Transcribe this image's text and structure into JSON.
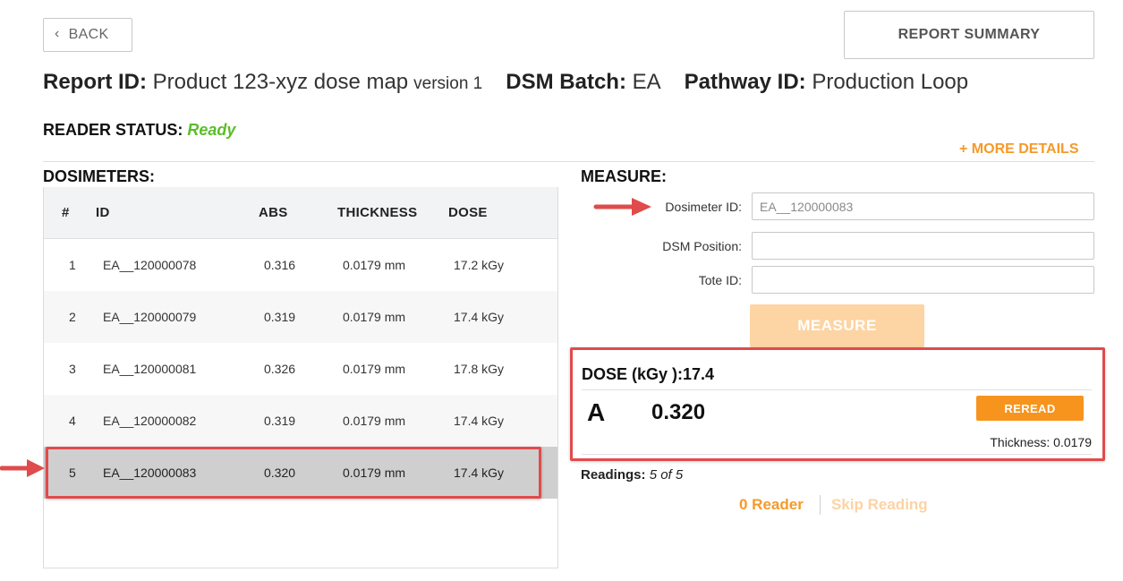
{
  "toolbar": {
    "back_label": "BACK",
    "report_summary_label": "REPORT SUMMARY"
  },
  "header": {
    "report_id_label": "Report ID:",
    "report_id_value": "Product 123-xyz dose map",
    "report_version": "version 1",
    "dsm_batch_label": "DSM Batch:",
    "dsm_batch_value": "EA",
    "pathway_id_label": "Pathway ID:",
    "pathway_id_value": "Production Loop"
  },
  "reader_status": {
    "label": "READER STATUS:",
    "value": "Ready",
    "value_color": "#5bbd2a"
  },
  "more_details_label": "+ MORE DETAILS",
  "dosimeters": {
    "title": "DOSIMETERS:",
    "columns": [
      "#",
      "ID",
      "ABS",
      "THICKNESS",
      "DOSE"
    ],
    "rows": [
      {
        "num": "1",
        "id": "EA__120000078",
        "abs": "0.316",
        "thickness": "0.0179 mm",
        "dose": "17.2 kGy"
      },
      {
        "num": "2",
        "id": "EA__120000079",
        "abs": "0.319",
        "thickness": "0.0179 mm",
        "dose": "17.4 kGy"
      },
      {
        "num": "3",
        "id": "EA__120000081",
        "abs": "0.326",
        "thickness": "0.0179 mm",
        "dose": "17.8 kGy"
      },
      {
        "num": "4",
        "id": "EA__120000082",
        "abs": "0.319",
        "thickness": "0.0179 mm",
        "dose": "17.4 kGy"
      },
      {
        "num": "5",
        "id": "EA__120000083",
        "abs": "0.320",
        "thickness": "0.0179 mm",
        "dose": "17.4 kGy"
      }
    ],
    "selected_row": 5
  },
  "measure": {
    "title": "MEASURE:",
    "dosimeter_id_label": "Dosimeter ID:",
    "dosimeter_id_value": "EA__120000083",
    "dsm_position_label": "DSM Position:",
    "dsm_position_value": "",
    "tote_id_label": "Tote ID:",
    "tote_id_value": "",
    "measure_button_label": "MEASURE"
  },
  "result": {
    "dose_label": "DOSE (kGy ):",
    "dose_value": "17.4",
    "reading_letter": "A",
    "reading_value": "0.320",
    "reread_label": "REREAD",
    "thickness_label": "Thickness:",
    "thickness_value": "0.0179"
  },
  "readings": {
    "label": "Readings:",
    "current": "5",
    "of_label": "of",
    "total": "5"
  },
  "footer_links": {
    "reader_label": "0 Reader",
    "skip_label": "Skip Reading"
  },
  "colors": {
    "accent_orange": "#f7941d",
    "highlight_red": "#e04b4b",
    "disabled_orange": "#fdd4a3"
  }
}
